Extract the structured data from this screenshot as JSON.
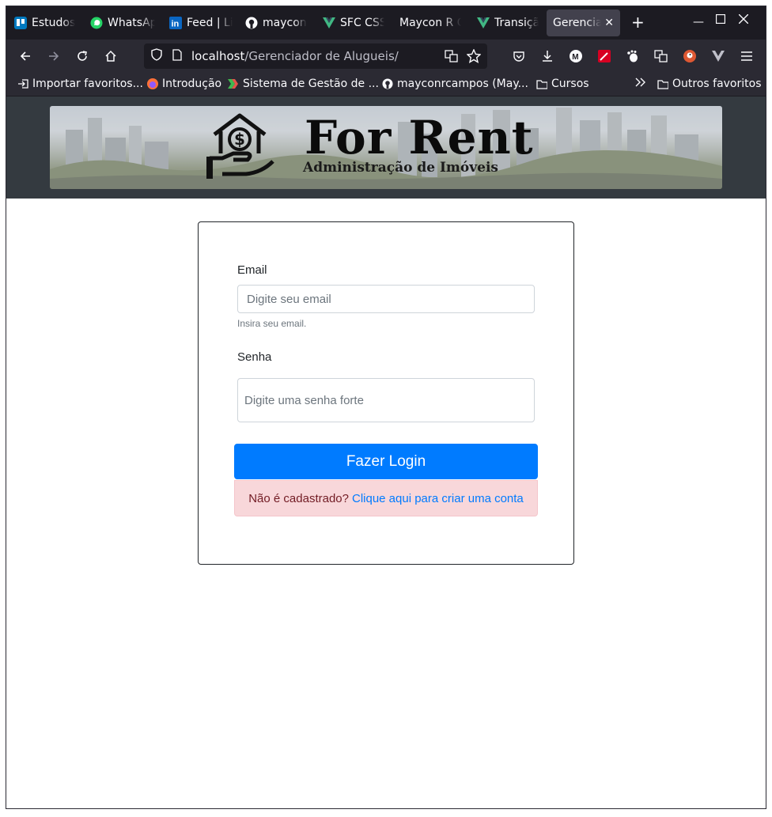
{
  "browser": {
    "tabs": [
      {
        "label": "Estudos",
        "icon": "trello-icon"
      },
      {
        "label": "WhatsApp",
        "icon": "whatsapp-icon"
      },
      {
        "label": "Feed | LinkedIn",
        "icon": "linkedin-icon"
      },
      {
        "label": "mayconrcampos",
        "icon": "github-icon"
      },
      {
        "label": "SFC CSS",
        "icon": "vue-icon"
      },
      {
        "label": "Maycon R C",
        "icon": ""
      },
      {
        "label": "Transição",
        "icon": "vue-icon"
      },
      {
        "label": "Gerenciador",
        "icon": "",
        "active": true
      }
    ],
    "url_host": "localhost",
    "url_path": "/Gerenciador de Alugueis/",
    "bookmarks": [
      {
        "label": "Importar favoritos...",
        "icon": "import-icon"
      },
      {
        "label": "Introdução",
        "icon": "firefox-icon"
      },
      {
        "label": "Sistema de Gestão de ...",
        "icon": "arrow-logo-icon"
      },
      {
        "label": "mayconrcampos (May...",
        "icon": "github-icon"
      },
      {
        "label": "Cursos",
        "icon": "folder-icon"
      }
    ],
    "other_bookmarks": "Outros favoritos",
    "colors": {
      "chrome_dark": "#1c1b22",
      "toolbar": "#2b2a33",
      "active_tab": "#42414d"
    }
  },
  "header": {
    "brand_title": "For Rent",
    "brand_subtitle": "Administração de Imóveis",
    "background": "#343a40"
  },
  "login": {
    "email_label": "Email",
    "email_placeholder": "Digite seu email",
    "email_help": "Insira seu email.",
    "password_label": "Senha",
    "password_placeholder": "Digite uma senha forte",
    "submit_label": "Fazer Login",
    "signup_prompt": "Não é cadastrado?",
    "signup_link": "Clique aqui para criar uma conta",
    "colors": {
      "primary": "#007bff",
      "alert_bg": "#f8d7da",
      "alert_text": "#721c24"
    }
  }
}
